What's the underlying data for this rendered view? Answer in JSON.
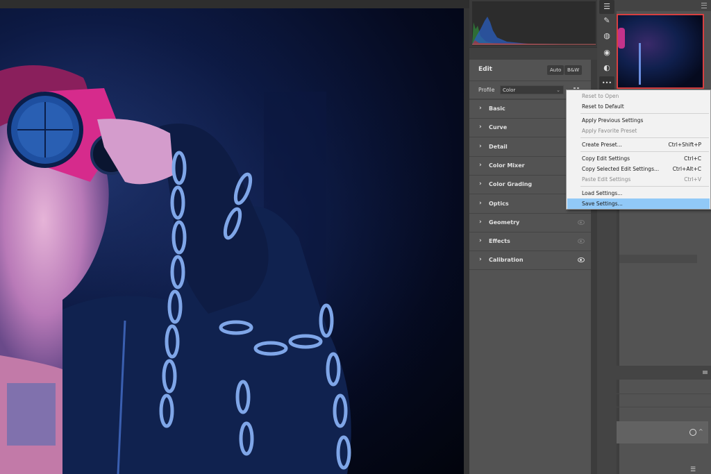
{
  "canvas": {
    "photo_description": "Portrait of a person in blue-tinted lighting wearing pink goggles, holding a chain"
  },
  "histogram": {
    "channels": [
      "red",
      "green",
      "blue"
    ]
  },
  "edit": {
    "title": "Edit",
    "auto_label": "Auto",
    "bw_label": "B&W",
    "profile_label": "Profile",
    "profile_value": "Color",
    "profile_browser_icon": "grid-icon",
    "sections": [
      {
        "label": "Basic",
        "eye": null
      },
      {
        "label": "Curve",
        "eye": null
      },
      {
        "label": "Detail",
        "eye": null
      },
      {
        "label": "Color Mixer",
        "eye": null
      },
      {
        "label": "Color Grading",
        "eye": null
      },
      {
        "label": "Optics",
        "eye": null
      },
      {
        "label": "Geometry",
        "eye": "dim"
      },
      {
        "label": "Effects",
        "eye": "dim"
      },
      {
        "label": "Calibration",
        "eye": "on"
      }
    ]
  },
  "toolstrip": {
    "tools": [
      {
        "name": "edit-sliders-icon",
        "glyph": "☰",
        "active": true
      },
      {
        "name": "healing-bandage-icon",
        "glyph": "✎",
        "active": false
      },
      {
        "name": "masking-icon",
        "glyph": "◍",
        "active": false
      },
      {
        "name": "red-eye-icon",
        "glyph": "◉",
        "active": false
      },
      {
        "name": "presets-icon",
        "glyph": "◐",
        "active": false
      },
      {
        "name": "more-options-icon",
        "glyph": "•••",
        "active": true
      }
    ]
  },
  "context_menu": {
    "items": [
      {
        "label": "Reset to Open",
        "shortcut": "",
        "disabled": true,
        "highlighted": false
      },
      {
        "label": "Reset to Default",
        "shortcut": "",
        "disabled": false,
        "highlighted": false
      },
      {
        "label": "Apply Previous Settings",
        "shortcut": "",
        "disabled": false,
        "highlighted": false
      },
      {
        "label": "Apply Favorite Preset",
        "shortcut": "",
        "disabled": true,
        "highlighted": false
      },
      {
        "label": "Create Preset...",
        "shortcut": "Ctrl+Shift+P",
        "disabled": false,
        "highlighted": false
      },
      {
        "label": "Copy Edit Settings",
        "shortcut": "Ctrl+C",
        "disabled": false,
        "highlighted": false
      },
      {
        "label": "Copy Selected Edit Settings...",
        "shortcut": "Ctrl+Alt+C",
        "disabled": false,
        "highlighted": false
      },
      {
        "label": "Paste Edit Settings",
        "shortcut": "Ctrl+V",
        "disabled": true,
        "highlighted": false
      },
      {
        "label": "Load Settings...",
        "shortcut": "",
        "disabled": false,
        "highlighted": false
      },
      {
        "label": "Save Settings...",
        "shortcut": "",
        "disabled": false,
        "highlighted": true
      }
    ]
  },
  "colors": {
    "panel_bg": "#535353",
    "menu_bg": "#f2f2f2",
    "menu_highlight": "#91c9f7",
    "navigator_border": "#d84040"
  }
}
